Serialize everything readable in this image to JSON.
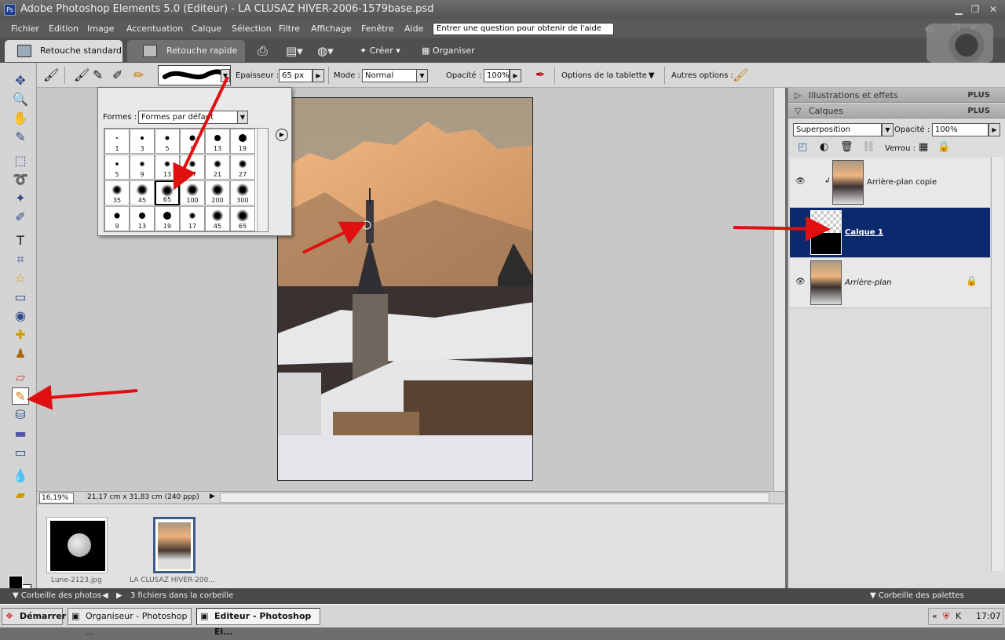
{
  "window": {
    "title": "Adobe Photoshop Elements 5.0 (Editeur) - LA CLUSAZ HIVER-2006-1579base.psd"
  },
  "menu": {
    "items": [
      "Fichier",
      "Edition",
      "Image",
      "Accentuation",
      "Calque",
      "Sélection",
      "Filtre",
      "Affichage",
      "Fenêtre",
      "Aide"
    ],
    "help_placeholder": "Entrer une question pour obtenir de l'aide"
  },
  "tabs": {
    "standard": "Retouche standard",
    "quick": "Retouche rapide"
  },
  "toolbar": {
    "create": "Créer",
    "organize": "Organiser"
  },
  "options": {
    "size_label": "Epaisseur :",
    "size_value": "65 px",
    "mode_label": "Mode :",
    "mode_value": "Normal",
    "opacity_label": "Opacité :",
    "opacity_value": "100%",
    "tablet_label": "Options de la tablette :",
    "more_label": "Autres options :"
  },
  "brush_popup": {
    "shapes_label": "Formes :",
    "shapes_value": "Formes par défaut",
    "brushes": [
      [
        "1",
        "3",
        "5",
        "9",
        "13",
        "19"
      ],
      [
        "5",
        "9",
        "13",
        "17",
        "21",
        "27"
      ],
      [
        "35",
        "45",
        "65",
        "100",
        "200",
        "300"
      ],
      [
        "9",
        "13",
        "19",
        "17",
        "45",
        "65"
      ]
    ],
    "selected": "65"
  },
  "status": {
    "zoom": "16,19%",
    "doc_info": "21,17 cm x 31,83 cm (240 ppp)"
  },
  "bin": {
    "thumbs": [
      {
        "caption": "Lune-2123.jpg"
      },
      {
        "caption": "LA CLUSAZ HIVER-200..."
      }
    ],
    "bar_left": "Corbeille des photos",
    "bar_count": "3 fichiers dans la corbeille",
    "bar_right": "Corbeille des palettes"
  },
  "palette": {
    "effects_title": "Illustrations et effets",
    "layers_title": "Calques",
    "plus": "PLUS",
    "blend_mode": "Superposition",
    "opacity_label": "Opacité :",
    "opacity_value": "100%",
    "lock_label": "Verrou :",
    "layers": [
      {
        "name": "Arrière-plan copie"
      },
      {
        "name": "Calque 1"
      },
      {
        "name": "Arrière-plan"
      }
    ]
  },
  "taskbar": {
    "start": "Démarrer",
    "task1": "Organiseur - Photoshop ...",
    "task2": "Editeur - Photoshop El...",
    "clock": "17:07"
  },
  "colors": {
    "selection": "#0b2a6e",
    "arrow": "#e01010",
    "chrome": "#5a5a5a"
  }
}
